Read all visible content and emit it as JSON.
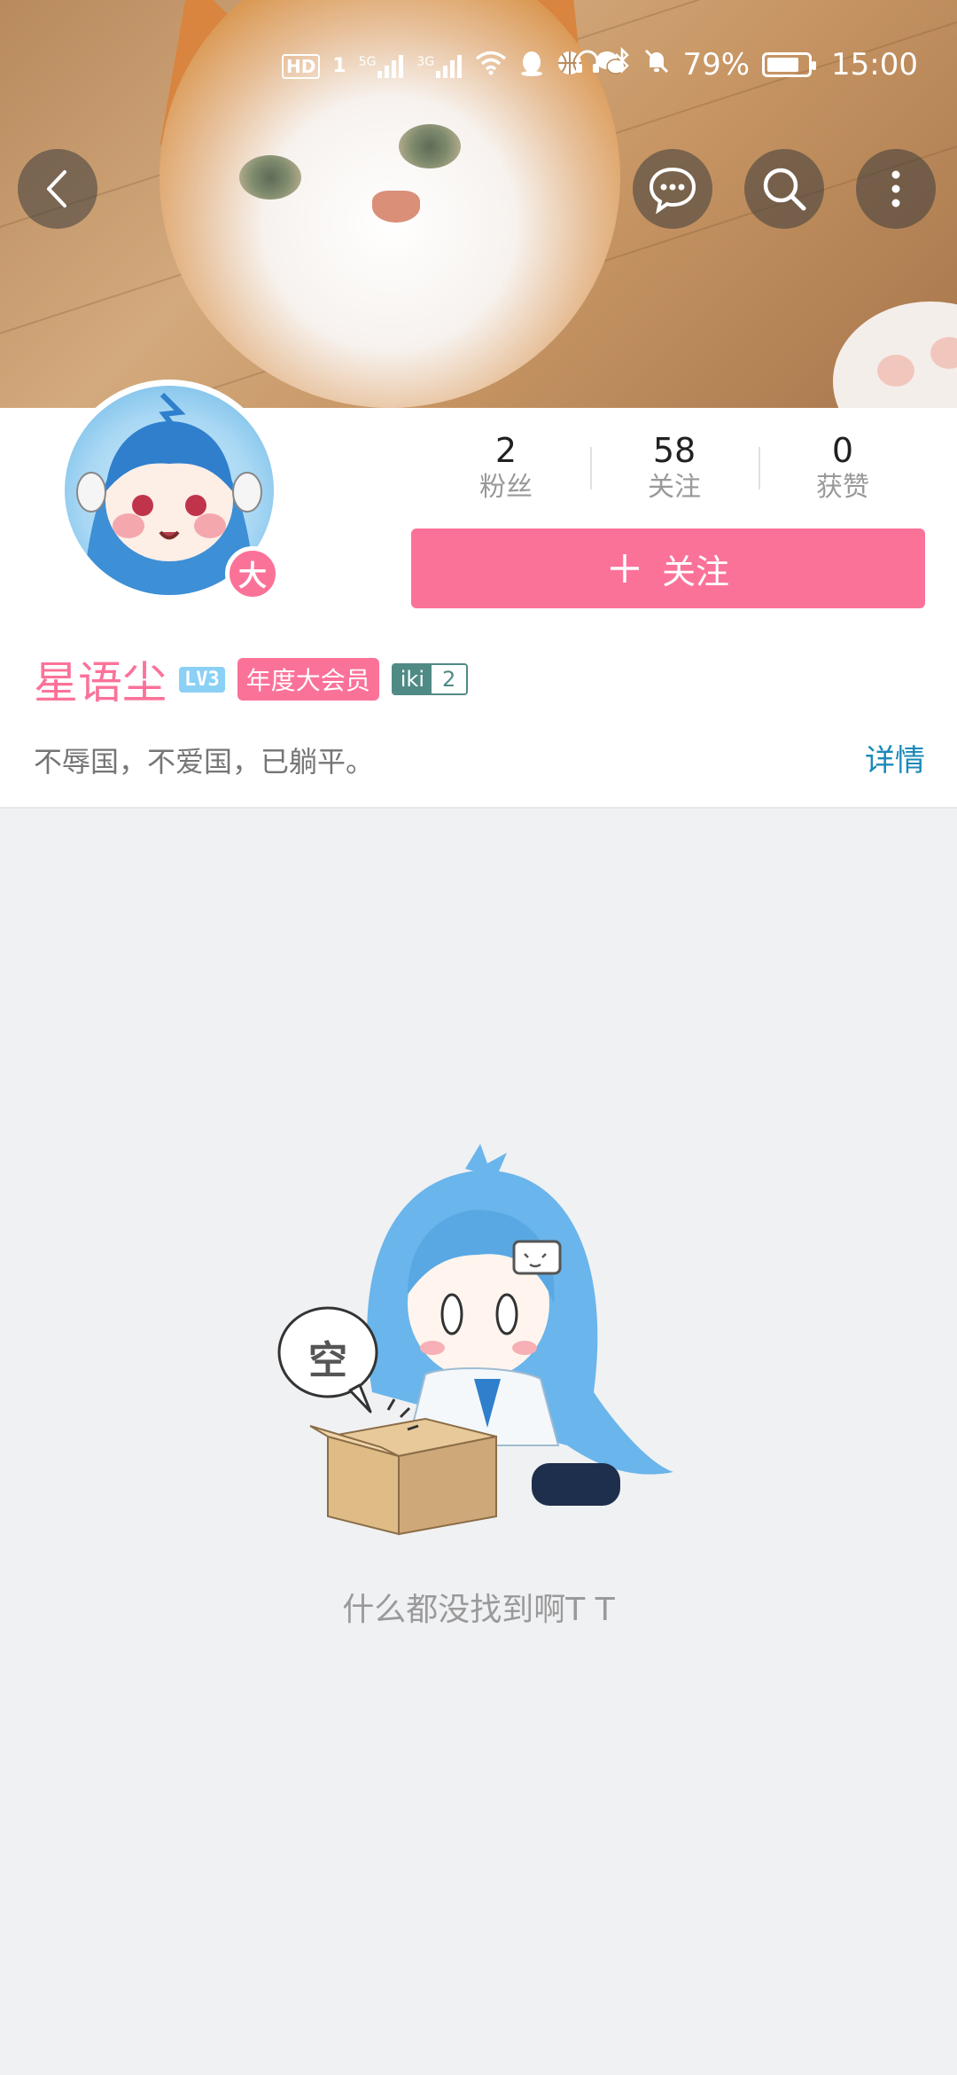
{
  "status_bar": {
    "left_icons": [
      "hd-icon",
      "sim1-icon",
      "signal-5g-icon",
      "signal-3g-icon",
      "wifi-icon",
      "qq-icon",
      "basketball-icon",
      "wechat-icon"
    ],
    "labels": {
      "hd": "HD",
      "sim": "1",
      "net1": "5G",
      "net2": "3G"
    },
    "right_icons": [
      "headphones-icon",
      "bluetooth-icon",
      "mute-icon"
    ],
    "battery_percent": "79%",
    "battery_level": 0.79,
    "time": "15:00"
  },
  "toolbar": {
    "back_icon": "chevron-left-icon",
    "message_icon": "chat-bubble-icon",
    "search_icon": "search-icon",
    "more_icon": "more-vertical-icon"
  },
  "profile": {
    "vip_badge": "大",
    "stats": [
      {
        "value": "2",
        "label": "粉丝"
      },
      {
        "value": "58",
        "label": "关注"
      },
      {
        "value": "0",
        "label": "获赞"
      }
    ],
    "follow_label": "关注",
    "follow_icon": "plus-icon",
    "username": "星语尘",
    "level": "LV3",
    "vip_tag": "年度大会员",
    "medal_name": "iki",
    "medal_level": "2",
    "bio": "不辱国，不爱国，已躺平。",
    "detail_link": "详情"
  },
  "empty_state": {
    "bubble_text": "空",
    "message": "什么都没找到啊T T"
  },
  "colors": {
    "accent": "#fb7299",
    "link": "#1a8ab8",
    "background": "#f0f1f3"
  }
}
